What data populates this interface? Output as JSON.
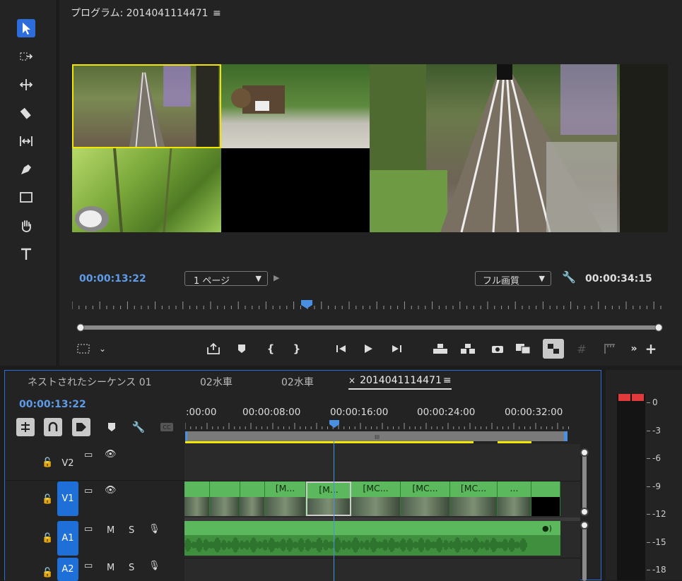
{
  "tools": [
    {
      "name": "selection-tool",
      "icon": "arrow-icon",
      "active": true
    },
    {
      "name": "track-select-tool",
      "icon": "track-select-icon"
    },
    {
      "name": "ripple-edit-tool",
      "icon": "ripple-icon"
    },
    {
      "name": "razor-tool",
      "icon": "razor-icon"
    },
    {
      "name": "slip-tool",
      "icon": "slip-icon"
    },
    {
      "name": "pen-tool",
      "icon": "pen-icon"
    },
    {
      "name": "rectangle-tool",
      "icon": "rectangle-icon"
    },
    {
      "name": "hand-tool",
      "icon": "hand-icon"
    },
    {
      "name": "type-tool",
      "icon": "type-icon"
    }
  ],
  "program": {
    "title": "プログラム: 2014041114471",
    "menu_glyph": "≡",
    "timecode_current": "00:00:13:22",
    "page_select": "1 ページ",
    "quality_select": "フル画質",
    "timecode_duration": "00:00:34:15"
  },
  "timeline": {
    "tabs": [
      {
        "label": "ネストされたシーケンス 01",
        "active": false
      },
      {
        "label": "02水車",
        "active": false
      },
      {
        "label": "02水車",
        "active": false
      },
      {
        "label": "2014041114471",
        "active": true,
        "close": "×",
        "menu": "≡"
      }
    ],
    "timecode": "00:00:13:22",
    "ruler_labels": [
      ":00:00",
      "00:00:08:00",
      "00:00:16:00",
      "00:00:24:00",
      "00:00:32:00"
    ],
    "tracks": {
      "v2": "V2",
      "v1": "V1",
      "a1": "A1",
      "a2": "A2",
      "mute": "M",
      "solo": "S"
    },
    "clips": [
      "",
      "",
      "",
      "[M...",
      "[M...",
      "[MC...",
      "[MC...",
      "[MC...",
      "...",
      ""
    ]
  },
  "meters": {
    "db_labels": [
      "0",
      "-3",
      "-6",
      "-9",
      "-12",
      "-15",
      "-18"
    ]
  },
  "colors": {
    "accent_blue": "#2d6ddb",
    "timecode_blue": "#5e9be8",
    "clip_green": "#5cb85c",
    "playhead": "#4a90e2",
    "selection_yellow": "#f2e600"
  }
}
